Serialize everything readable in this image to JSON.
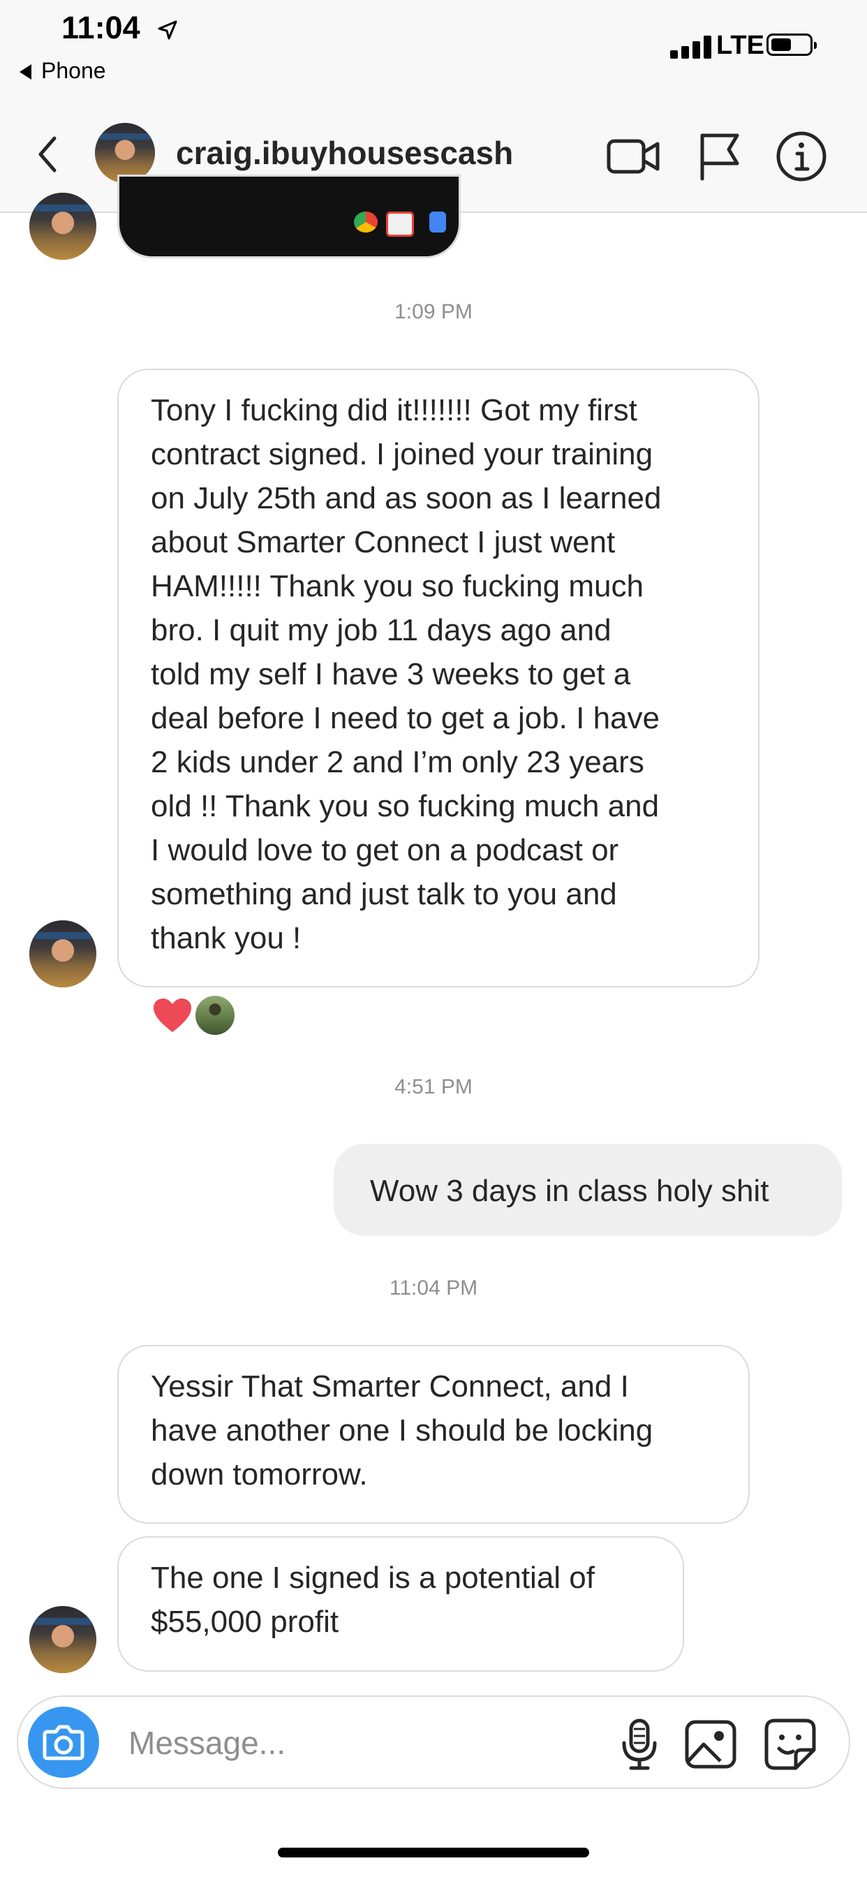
{
  "status_bar": {
    "time": "11:04",
    "back_app": "Phone",
    "network": "LTE"
  },
  "header": {
    "username": "craig.ibuyhousescash",
    "icons": [
      "back-chevron-icon",
      "video-call-icon",
      "flag-icon",
      "info-icon"
    ]
  },
  "thread": {
    "timestamp_1": "1:09 PM",
    "message_1": "Tony I fucking did it!!!!!!! Got my first\ncontract signed. I joined your training\non July 25th and as soon as I learned\nabout Smarter Connect I just went\nHAM!!!!! Thank you  so fucking much\nbro. I quit my job 11 days ago and\ntold my self I have 3 weeks to get a\ndeal before I need to get a job. I have\n2 kids under 2 and I’m only 23 years\nold !! Thank you so fucking much and\nI would love to get on a podcast or\nsomething and just talk to you and\nthank you !",
    "timestamp_2": "4:51 PM",
    "message_2": "Wow 3 days in class holy shit",
    "timestamp_3": "11:04 PM",
    "message_3": "Yessir That Smarter Connect, and I\nhave another one I should be locking\ndown tomorrow.",
    "message_4": "The one I signed is a potential of\n$55,000 profit"
  },
  "composer": {
    "placeholder": "Message...",
    "icons": [
      "camera-icon",
      "microphone-icon",
      "gallery-icon",
      "sticker-icon"
    ]
  },
  "colors": {
    "accent": "#3797f0",
    "reaction_heart": "#ed4956",
    "timestamp": "#8e8e8e"
  }
}
